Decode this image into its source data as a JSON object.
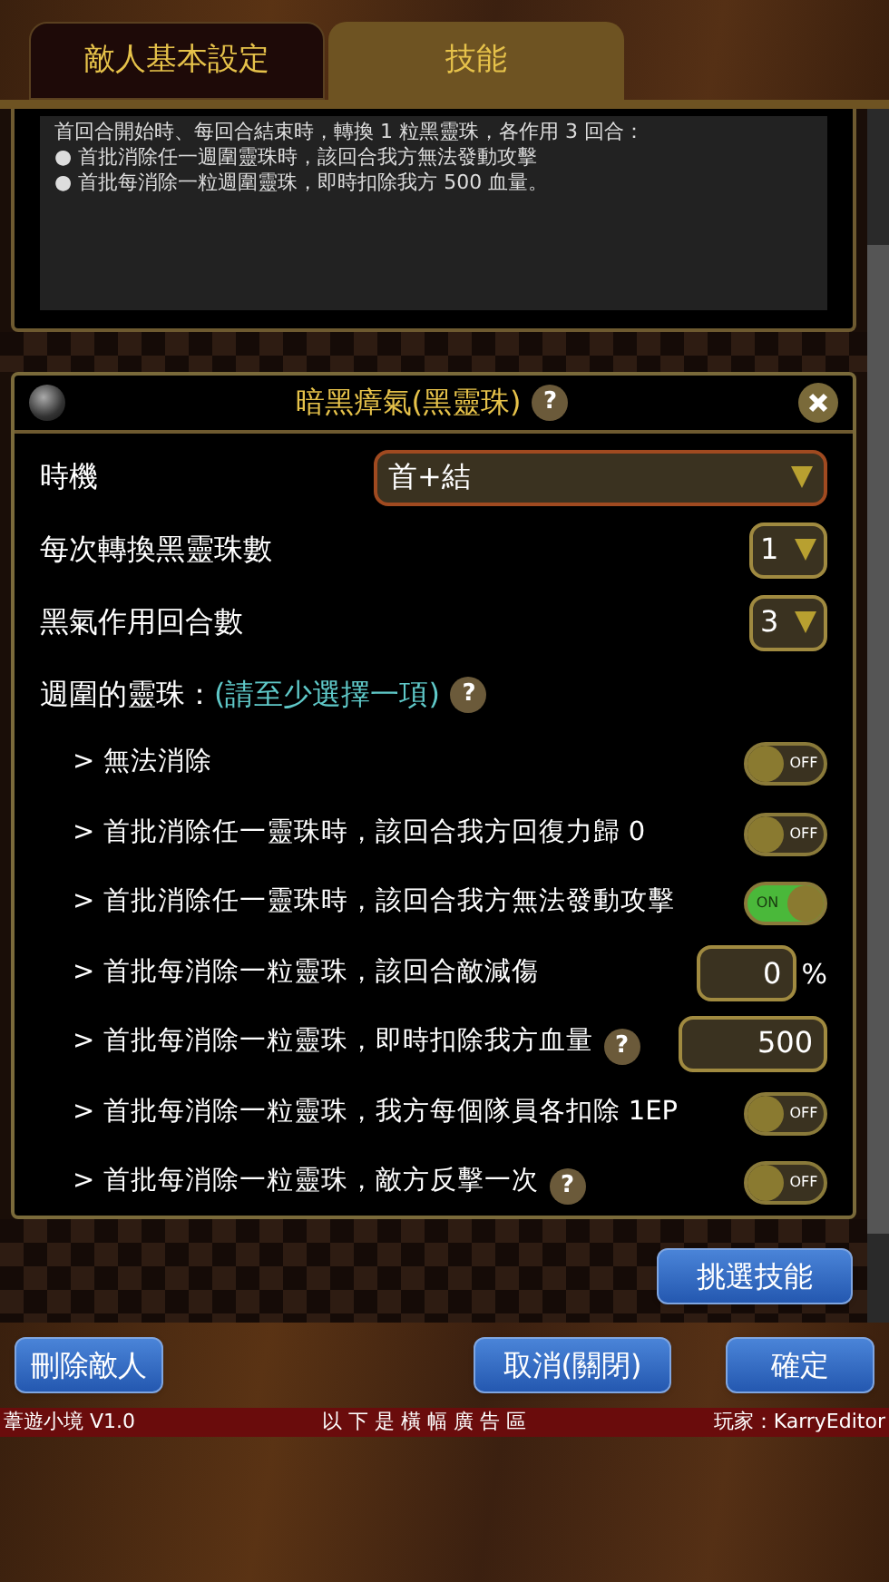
{
  "tabs": [
    {
      "label": "敵人基本設定",
      "selected": false
    },
    {
      "label": "技能",
      "selected": true
    }
  ],
  "description": {
    "lines": [
      "首回合開始時、每回合結束時，轉換 1 粒黑靈珠，各作用 3 回合：",
      "● 首批消除任一週圍靈珠時，該回合我方無法發動攻擊",
      "● 首批每消除一粒週圍靈珠，即時扣除我方 500 血量。"
    ]
  },
  "dialog": {
    "title": "暗黑瘴氣(黑靈珠)",
    "help": "?",
    "fields": [
      {
        "label": "時機",
        "value": "首+結",
        "kind": "wide"
      },
      {
        "label": "每次轉換黑靈珠數",
        "value": "1",
        "kind": "small"
      },
      {
        "label": "黑氣作用回合數",
        "value": "3",
        "kind": "small"
      }
    ],
    "section": {
      "label": "週圍的靈珠：",
      "note": "(請至少選擇一項)",
      "help": "?"
    },
    "options": [
      {
        "label": "> 無法消除",
        "kind": "toggle",
        "on": false,
        "toggle_text": "OFF"
      },
      {
        "label": "> 首批消除任一靈珠時，該回合我方回復力歸 0",
        "kind": "toggle",
        "on": false,
        "toggle_text": "OFF"
      },
      {
        "label": "> 首批消除任一靈珠時，該回合我方無法發動攻擊",
        "kind": "toggle",
        "on": true,
        "toggle_text": "ON"
      },
      {
        "label": "> 首批每消除一粒靈珠，該回合敵減傷",
        "kind": "percent",
        "value": "0",
        "unit": "%"
      },
      {
        "label": "> 首批每消除一粒靈珠，即時扣除我方血量",
        "kind": "number",
        "value": "500",
        "help": "?"
      },
      {
        "label": "> 首批每消除一粒靈珠，我方每個隊員各扣除 1EP",
        "kind": "toggle",
        "on": false,
        "toggle_text": "OFF"
      },
      {
        "label": "> 首批每消除一粒靈珠，敵方反擊一次",
        "kind": "toggle",
        "on": false,
        "toggle_text": "OFF",
        "help": "?"
      }
    ]
  },
  "pick_button": "挑選技能",
  "footer_buttons": [
    "刪除敵人",
    "取消(關閉)",
    "確定"
  ],
  "status_bar": {
    "app": "葦遊小境 V1.0",
    "ad": "以 下 是 橫 幅 廣 告 區",
    "player": "玩家：KarryEditor"
  }
}
